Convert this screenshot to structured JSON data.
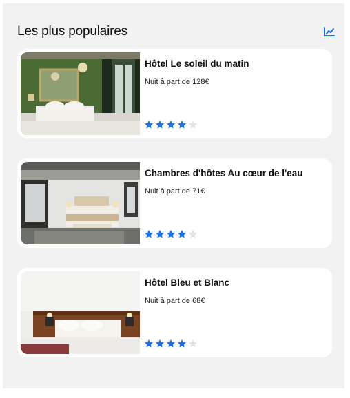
{
  "section": {
    "title": "Les plus populaires",
    "trend_icon": "trending-chart-icon"
  },
  "colors": {
    "accent": "#1a73e8",
    "star_filled": "#1a73e8",
    "star_empty": "#e3e3e3",
    "panel_bg": "#f2f2f2",
    "card_bg": "#ffffff"
  },
  "hotels": [
    {
      "name": "Hôtel Le soleil du matin",
      "price": "Nuit à part de 128€",
      "rating": 4,
      "rating_max": 5
    },
    {
      "name": "Chambres d'hôtes Au cœur de l'eau",
      "price": "Nuit à part de 71€",
      "rating": 4,
      "rating_max": 5
    },
    {
      "name": "Hôtel Bleu et Blanc",
      "price": "Nuit à part de 68€",
      "rating": 4,
      "rating_max": 5
    }
  ]
}
